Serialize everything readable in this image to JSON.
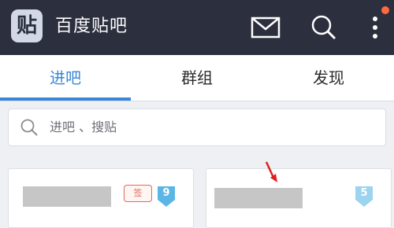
{
  "app": {
    "title": "百度贴吧",
    "logo_glyph": "贴"
  },
  "header_icons": [
    "mail-icon",
    "search-icon",
    "more-vertical-icon"
  ],
  "tabs": [
    {
      "label": "进吧",
      "active": true
    },
    {
      "label": "群组",
      "active": false
    },
    {
      "label": "发现",
      "active": false
    }
  ],
  "search": {
    "placeholder": "进吧 、搜贴"
  },
  "forum_cards": [
    {
      "name": "",
      "badge": "签",
      "level": "9"
    },
    {
      "name": "",
      "level": "5"
    }
  ],
  "colors": {
    "topbar": "#2b2f3e",
    "accent": "#3a86d8",
    "badge_red": "#e06a5a",
    "level_blue": "#5bb6e6"
  }
}
